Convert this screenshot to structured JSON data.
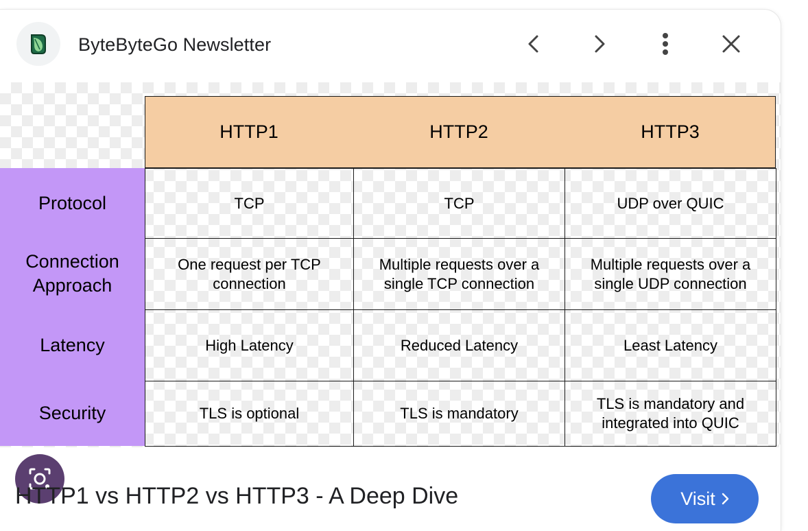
{
  "header": {
    "source_name": "ByteByteGo Newsletter",
    "icons": {
      "source_logo": "leaf-logo-icon",
      "prev": "chevron-left-icon",
      "next": "chevron-right-icon",
      "more": "more-vert-icon",
      "close": "close-icon",
      "lens": "google-lens-icon"
    }
  },
  "table": {
    "columns": [
      "HTTP1",
      "HTTP2",
      "HTTP3"
    ],
    "rows": [
      {
        "label": "Protocol",
        "cells": [
          "TCP",
          "TCP",
          "UDP over QUIC"
        ]
      },
      {
        "label": "Connection Approach",
        "cells": [
          "One request per TCP connection",
          "Multiple requests over a single TCP connection",
          "Multiple requests over a single UDP connection"
        ]
      },
      {
        "label": "Latency",
        "cells": [
          "High Latency",
          "Reduced Latency",
          "Least Latency"
        ]
      },
      {
        "label": "Security",
        "cells": [
          "TLS is optional",
          "TLS is mandatory",
          "TLS is mandatory and integrated into QUIC"
        ]
      }
    ],
    "colors": {
      "column_header": "#f5cda3",
      "row_header": "#c397f7"
    }
  },
  "footer": {
    "title": "HTTP1 vs HTTP2 vs HTTP3 - A Deep Dive",
    "visit_label": "Visit",
    "visit_color": "#3b73d9"
  }
}
